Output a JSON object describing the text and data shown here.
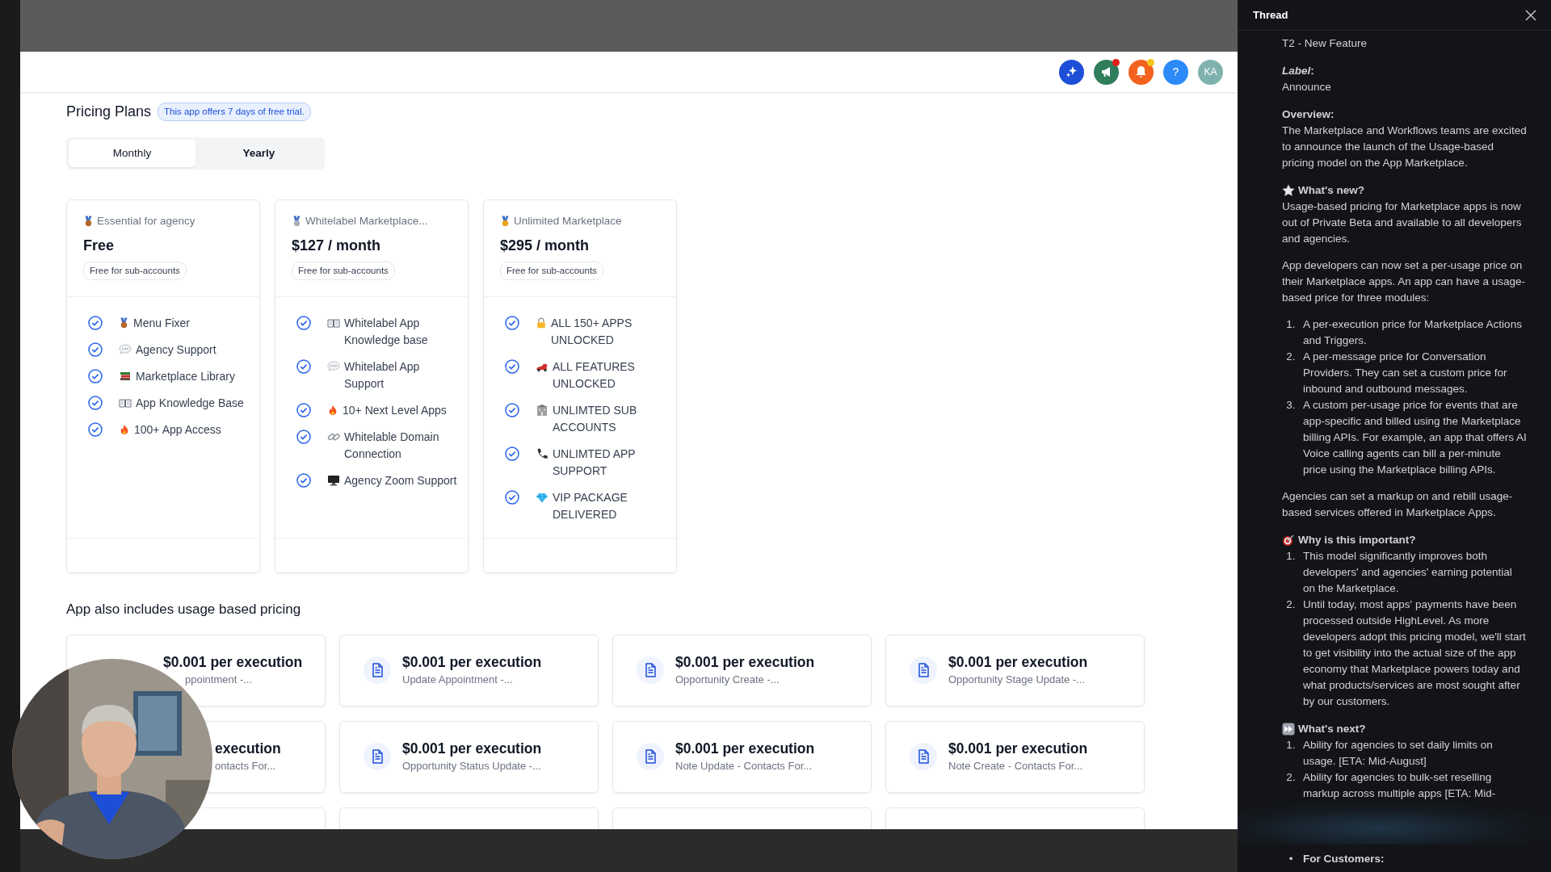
{
  "header": {
    "buttons": [
      {
        "kind": "sparkle",
        "color": "#1d4ed8"
      },
      {
        "kind": "megaphone",
        "color": "#2f7d5a",
        "dot": {
          "color": "#e11d1d"
        }
      },
      {
        "kind": "bell",
        "color": "#f4621f",
        "dot": {
          "color": "#f5c518"
        }
      },
      {
        "kind": "help",
        "color": "#2b8af7",
        "text": "?"
      },
      {
        "kind": "avatar",
        "color": "#7fb2ae",
        "text": "KA"
      }
    ]
  },
  "pricing": {
    "title": "Pricing Plans",
    "trial_badge": "This app offers 7 days of free trial.",
    "billing_tabs": [
      {
        "label": "Monthly",
        "selected": true
      },
      {
        "label": "Yearly",
        "selected": false
      }
    ],
    "plans": [
      {
        "color": "#b5652b",
        "name": "Essential for agency",
        "price": "Free",
        "note": "Free for sub-accounts",
        "features": [
          {
            "kind": "medal",
            "text": "Menu Fixer"
          },
          {
            "kind": "bubble",
            "text": "Agency Support"
          },
          {
            "kind": "books",
            "text": "Marketplace Library"
          },
          {
            "kind": "book",
            "text": "App Knowledge Base"
          },
          {
            "kind": "fire",
            "text": "100+ App Access"
          }
        ]
      },
      {
        "color": "#a9aeb5",
        "name": "Whitelabel Marketplace...",
        "price": "$127 / month",
        "note": "Free for sub-accounts",
        "features": [
          {
            "kind": "book",
            "text": "Whitelabel App Knowledge base"
          },
          {
            "kind": "bubble",
            "text": "Whitelabel App Support"
          },
          {
            "kind": "fire",
            "text": "10+ Next Level Apps"
          },
          {
            "kind": "link",
            "text": "Whitelable Domain Connection"
          },
          {
            "kind": "monitor",
            "text": "Agency Zoom Support"
          }
        ]
      },
      {
        "color": "#e8a317",
        "name": "Unlimited Marketplace",
        "price": "$295 / month",
        "note": "Free for sub-accounts",
        "features": [
          {
            "kind": "lock",
            "text": "ALL 150+ APPS UNLOCKED"
          },
          {
            "kind": "car",
            "text": "ALL FEATURES UNLOCKED"
          },
          {
            "kind": "building",
            "text": "UNLIMTED SUB ACCOUNTS"
          },
          {
            "kind": "phone",
            "text": "UNLIMTED APP SUPPORT"
          },
          {
            "kind": "gem",
            "text": "VIP PACKAGE DELIVERED"
          }
        ]
      }
    ]
  },
  "usage": {
    "title": "App also includes usage based pricing",
    "rows": [
      [
        {
          "kind": "partial",
          "title": "$0.001 per execution",
          "subtitle": "ppointment -..."
        },
        {
          "kind": "full",
          "title": "$0.001 per execution",
          "subtitle": "Update Appointment -..."
        },
        {
          "kind": "full",
          "title": "$0.001 per execution",
          "subtitle": "Opportunity Create -..."
        },
        {
          "kind": "full",
          "title": "$0.001 per execution",
          "subtitle": "Opportunity Stage Update -..."
        }
      ],
      [
        {
          "kind": "partial",
          "title": "execution",
          "subtitle": "ontacts For..."
        },
        {
          "kind": "full",
          "title": "$0.001 per execution",
          "subtitle": "Opportunity Status Update -..."
        },
        {
          "kind": "full",
          "title": "$0.001 per execution",
          "subtitle": "Note Update - Contacts For..."
        },
        {
          "kind": "full",
          "title": "$0.001 per execution",
          "subtitle": "Note Create - Contacts For..."
        }
      ],
      [
        {
          "kind": "partial"
        },
        {
          "kind": "full"
        },
        {
          "kind": "full"
        },
        {
          "kind": "full"
        }
      ]
    ]
  },
  "thread": {
    "title": "Thread",
    "sections": [
      {
        "blocks": [
          {
            "kind": "para",
            "text": "T2 - New Feature"
          }
        ]
      },
      {
        "heading": "*Label*:",
        "blocks": [
          {
            "kind": "para",
            "text": "Announce"
          }
        ]
      },
      {
        "heading": "Overview:",
        "blocks": [
          {
            "kind": "para",
            "text": "The Marketplace and Workflows teams are excited to announce the launch of the Usage-based pricing model on the App Marketplace."
          }
        ]
      },
      {
        "kind": "star",
        "heading": "What's new?",
        "blocks": [
          {
            "kind": "para",
            "text": "Usage-based pricing for Marketplace apps is now out of Private Beta and available to all developers and agencies."
          },
          {
            "kind": "para",
            "text": "App developers can now set a per-usage price on their Marketplace apps. An app can have a usage-based price for three modules:"
          },
          {
            "kind": "list",
            "items": [
              {
                "marker": "1.",
                "text": "A per-execution price for Marketplace Actions and Triggers."
              },
              {
                "marker": "2.",
                "text": "A per-message price for Conversation Providers. They can set a custom price for inbound and outbound messages."
              },
              {
                "marker": "3.",
                "text": "A custom per-usage price for events that are app-specific and billed using the Marketplace billing APIs. For example, an app that offers AI Voice calling agents can bill a per-minute price using the Marketplace billing APIs."
              }
            ]
          },
          {
            "kind": "para",
            "text": "Agencies can set a markup on and rebill usage-based services offered in Marketplace Apps."
          }
        ]
      },
      {
        "kind": "target",
        "heading": "Why is this important?",
        "blocks": [
          {
            "kind": "list",
            "items": [
              {
                "marker": "1.",
                "text": "This model significantly improves both developers' and agencies' earning potential on the Marketplace."
              },
              {
                "marker": "2.",
                "text": "Until today, most apps' payments have been processed outside HighLevel. As more developers adopt this pricing model, we'll start to get visibility into the actual size of the app economy that Marketplace powers today and what products/services are most sought after by our customers."
              }
            ]
          }
        ]
      },
      {
        "kind": "fastforward",
        "heading": "What's next?",
        "blocks": [
          {
            "kind": "list",
            "items": [
              {
                "marker": "1.",
                "text": "Ability for agencies to set daily limits on usage. [ETA: Mid-August]"
              },
              {
                "marker": "2.",
                "text": "Ability for agencies to bulk-set reselling markup across multiple apps [ETA: Mid-"
              }
            ]
          }
        ]
      },
      {
        "kind": "blurred"
      },
      {
        "kind": "last",
        "blocks": [
          {
            "kind": "list",
            "bold": true,
            "items": [
              {
                "marker": "•",
                "text": "For Customers:"
              }
            ]
          }
        ]
      }
    ]
  }
}
